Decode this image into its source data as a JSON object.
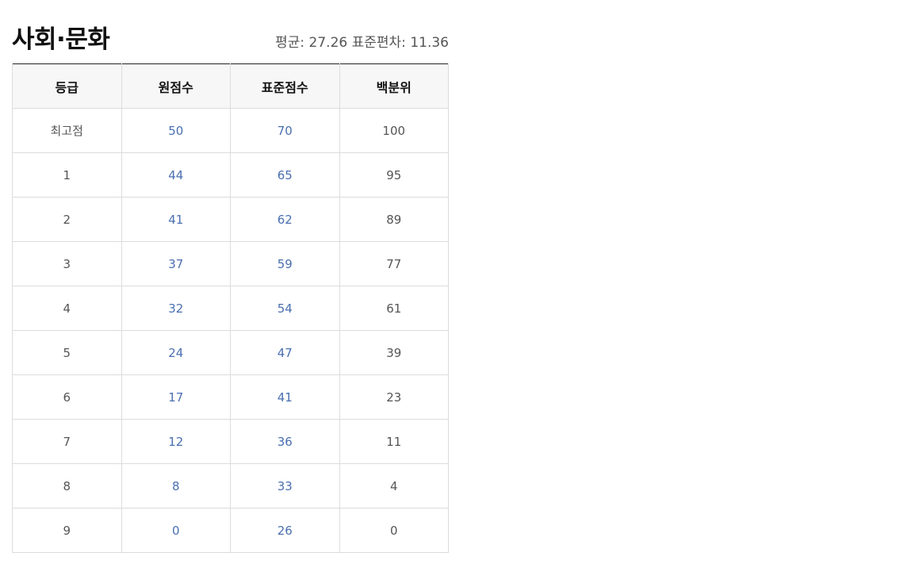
{
  "title": "사회·문화",
  "stats": {
    "mean_label": "평균: ",
    "mean_value": "27.26",
    "sd_label": " 표준편차: ",
    "sd_value": "11.36"
  },
  "table": {
    "headers": [
      "등급",
      "원점수",
      "표준점수",
      "백분위"
    ],
    "rows": [
      [
        "최고점",
        "50",
        "70",
        "100"
      ],
      [
        "1",
        "44",
        "65",
        "95"
      ],
      [
        "2",
        "41",
        "62",
        "89"
      ],
      [
        "3",
        "37",
        "59",
        "77"
      ],
      [
        "4",
        "32",
        "54",
        "61"
      ],
      [
        "5",
        "24",
        "47",
        "39"
      ],
      [
        "6",
        "17",
        "41",
        "23"
      ],
      [
        "7",
        "12",
        "36",
        "11"
      ],
      [
        "8",
        "8",
        "33",
        "4"
      ],
      [
        "9",
        "0",
        "26",
        "0"
      ]
    ]
  },
  "colors": {
    "link_blue": "#4a6fb0",
    "header_bg": "#f7f7f7",
    "border": "#dcdcdc"
  }
}
